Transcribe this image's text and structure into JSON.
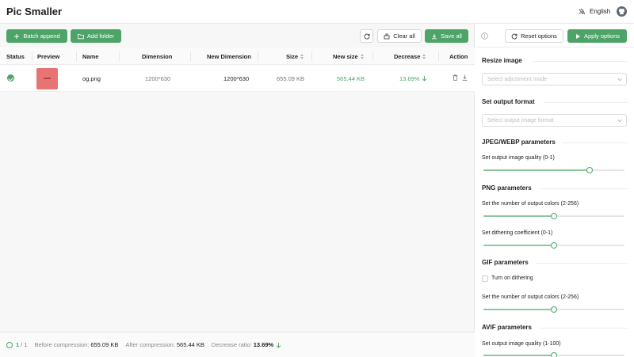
{
  "app": {
    "title": "Pic Smaller",
    "language": "English"
  },
  "toolbar": {
    "batch_append": "Batch append",
    "add_folder": "Add folder",
    "clear_all": "Clear all",
    "save_all": "Save all"
  },
  "table": {
    "headers": {
      "status": "Status",
      "preview": "Preview",
      "name": "Name",
      "dimension": "Dimension",
      "new_dimension": "New Dimension",
      "size": "Size",
      "new_size": "New size",
      "decrease": "Decrease",
      "action": "Action"
    },
    "rows": [
      {
        "status": "done",
        "name": "og.png",
        "dimension": "1200*630",
        "new_dimension": "1200*630",
        "size": "655.09 KB",
        "new_size": "565.44 KB",
        "decrease": "13.69%"
      }
    ]
  },
  "status_bar": {
    "done": "1",
    "total": "/ 1",
    "before_label": "Before compression:",
    "before_value": "655.09 KB",
    "after_label": "After compression:",
    "after_value": "565.44 KB",
    "ratio_label": "Decrease ratio:",
    "ratio_value": "13.69%"
  },
  "options": {
    "reset": "Reset options",
    "apply": "Apply options",
    "resize_title": "Resize image",
    "resize_placeholder": "Select adjustment mode",
    "format_title": "Set output format",
    "format_placeholder": "Select output image format",
    "jpeg_title": "JPEG/WEBP parameters",
    "jpeg_quality_label": "Set output image quality (0-1)",
    "jpeg_quality": 0.75,
    "png_title": "PNG parameters",
    "png_colors_label": "Set the number of output colors (2-256)",
    "png_colors_fraction": 0.5,
    "png_dither_label": "Set dithering coefficient (0-1)",
    "png_dither": 0.5,
    "gif_title": "GIF parameters",
    "gif_dither_label": "Turn on dithering",
    "gif_dither_on": false,
    "gif_colors_label": "Set the number of output colors (2-256)",
    "gif_colors_fraction": 0.5,
    "avif_title": "AVIF parameters",
    "avif_quality_label": "Set output image quality (1-100)",
    "avif_quality_fraction": 0.5
  },
  "colors": {
    "accent": "#4ea468",
    "accent_light": "#8ec69e"
  }
}
